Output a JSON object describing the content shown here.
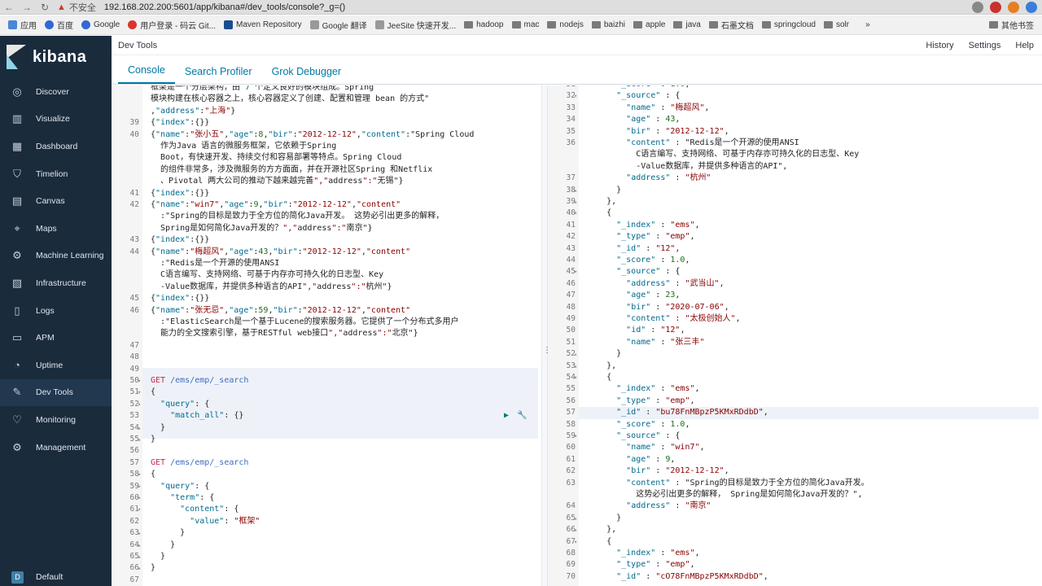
{
  "browser": {
    "warning": "不安全",
    "url": "192.168.202.200:5601/app/kibana#/dev_tools/console?_g=()"
  },
  "bookmarks": [
    {
      "label": "应用",
      "icon": "grid"
    },
    {
      "label": "百度",
      "icon": "paw"
    },
    {
      "label": "Google",
      "icon": "google"
    },
    {
      "label": "用户登录 - 码云 Git...",
      "icon": "gitee"
    },
    {
      "label": "Maven Repository",
      "icon": "mvn"
    },
    {
      "label": "Google 翻译",
      "icon": "translate"
    },
    {
      "label": "JeeSite 快速开发...",
      "icon": "jeesite"
    },
    {
      "label": "hadoop",
      "icon": "folder"
    },
    {
      "label": "mac",
      "icon": "folder"
    },
    {
      "label": "nodejs",
      "icon": "folder"
    },
    {
      "label": "baizhi",
      "icon": "folder"
    },
    {
      "label": "apple",
      "icon": "folder"
    },
    {
      "label": "java",
      "icon": "folder"
    },
    {
      "label": "石墨文档",
      "icon": "folder"
    },
    {
      "label": "springcloud",
      "icon": "folder"
    },
    {
      "label": "solr",
      "icon": "folder"
    }
  ],
  "bookmarks_more": "»",
  "bookmarks_other": "其他书签",
  "sidebar": {
    "brand": "kibana",
    "items": [
      {
        "label": "Discover",
        "icon": "compass-icon",
        "glyph": "◎",
        "active": false
      },
      {
        "label": "Visualize",
        "icon": "chart-icon",
        "glyph": "▥",
        "active": false
      },
      {
        "label": "Dashboard",
        "icon": "dashboard-icon",
        "glyph": "▦",
        "active": false
      },
      {
        "label": "Timelion",
        "icon": "shield-icon",
        "glyph": "⛉",
        "active": false
      },
      {
        "label": "Canvas",
        "icon": "canvas-icon",
        "glyph": "▤",
        "active": false
      },
      {
        "label": "Maps",
        "icon": "map-pin-icon",
        "glyph": "⌖",
        "active": false
      },
      {
        "label": "Machine Learning",
        "icon": "ml-icon",
        "glyph": "⚙",
        "active": false
      },
      {
        "label": "Infrastructure",
        "icon": "infra-icon",
        "glyph": "▧",
        "active": false
      },
      {
        "label": "Logs",
        "icon": "logs-icon",
        "glyph": "▯",
        "active": false
      },
      {
        "label": "APM",
        "icon": "apm-icon",
        "glyph": "▭",
        "active": false
      },
      {
        "label": "Uptime",
        "icon": "uptime-icon",
        "glyph": "◔",
        "active": false
      },
      {
        "label": "Dev Tools",
        "icon": "wrench-icon",
        "glyph": "✎",
        "active": true
      },
      {
        "label": "Monitoring",
        "icon": "heartbeat-icon",
        "glyph": "♡",
        "active": false
      },
      {
        "label": "Management",
        "icon": "gear-icon",
        "glyph": "⚙",
        "active": false
      }
    ],
    "space_initial": "D",
    "space_label": "Default"
  },
  "header": {
    "title": "Dev Tools",
    "links": [
      "History",
      "Settings",
      "Help"
    ]
  },
  "tabs": [
    {
      "label": "Console",
      "active": true
    },
    {
      "label": "Search Profiler",
      "active": false
    },
    {
      "label": "Grok Debugger",
      "active": false
    }
  ],
  "left_editor": [
    {
      "n": "",
      "text": "框架是一个分层架构，由 7 个定义良好的模块组成。Spring"
    },
    {
      "n": "",
      "text": "模块构建在核心容器之上，核心容器定义了创建、配置和管理 bean 的方式\""
    },
    {
      "n": "",
      "text": ",\"address\":\"上海\"}"
    },
    {
      "n": "39",
      "text": "{\"index\":{}}"
    },
    {
      "n": "40",
      "text": "{\"name\":\"张小五\",\"age\":8,\"bir\":\"2012-12-12\",\"content\":\"Spring Cloud"
    },
    {
      "n": "",
      "text": "  作为Java 语言的微服务框架，它依赖于Spring"
    },
    {
      "n": "",
      "text": "  Boot，有快速开发、持续交付和容易部署等特点。Spring Cloud"
    },
    {
      "n": "",
      "text": "  的组件非常多，涉及微服务的方方面面，并在开源社区Spring 和Netflix"
    },
    {
      "n": "",
      "text": "  、Pivotal 两大公司的推动下越来越完善\",\"address\":\"无锡\"}"
    },
    {
      "n": "41",
      "text": "{\"index\":{}}"
    },
    {
      "n": "42",
      "text": "{\"name\":\"win7\",\"age\":9,\"bir\":\"2012-12-12\",\"content\""
    },
    {
      "n": "",
      "text": "  :\"Spring的目标是致力于全方位的简化Java开发。 这势必引出更多的解释，"
    },
    {
      "n": "",
      "text": "  Spring是如何简化Java开发的？\",\"address\":\"南京\"}"
    },
    {
      "n": "43",
      "text": "{\"index\":{}}"
    },
    {
      "n": "44",
      "text": "{\"name\":\"梅超风\",\"age\":43,\"bir\":\"2012-12-12\",\"content\""
    },
    {
      "n": "",
      "text": "  :\"Redis是一个开源的使用ANSI"
    },
    {
      "n": "",
      "text": "  C语言编写、支持网络、可基于内存亦可持久化的日志型、Key"
    },
    {
      "n": "",
      "text": "  -Value数据库，并提供多种语言的API\",\"address\":\"杭州\"}"
    },
    {
      "n": "45",
      "text": "{\"index\":{}}"
    },
    {
      "n": "46",
      "text": "{\"name\":\"张无忌\",\"age\":59,\"bir\":\"2012-12-12\",\"content\""
    },
    {
      "n": "",
      "text": "  :\"ElasticSearch是一个基于Lucene的搜索服务器。它提供了一个分布式多用户"
    },
    {
      "n": "",
      "text": "  能力的全文搜索引擎，基于RESTful web接口\",\"address\":\"北京\"}"
    },
    {
      "n": "47",
      "text": ""
    },
    {
      "n": "48",
      "text": ""
    },
    {
      "n": "49",
      "text": ""
    },
    {
      "n": "50",
      "text": "GET /ems/emp/_search",
      "kind": "request",
      "fold": "▾"
    },
    {
      "n": "51",
      "text": "{",
      "fold": "▾"
    },
    {
      "n": "52",
      "text": "  \"query\": {",
      "fold": "▾"
    },
    {
      "n": "53",
      "text": "    \"match_all\": {}"
    },
    {
      "n": "54",
      "text": "  }",
      "fold": "▴"
    },
    {
      "n": "55",
      "text": "}",
      "fold": "▴"
    },
    {
      "n": "56",
      "text": ""
    },
    {
      "n": "57",
      "text": "GET /ems/emp/_search",
      "kind": "request"
    },
    {
      "n": "58",
      "text": "{",
      "fold": "▾"
    },
    {
      "n": "59",
      "text": "  \"query\": {",
      "fold": "▾"
    },
    {
      "n": "60",
      "text": "    \"term\": {",
      "fold": "▾"
    },
    {
      "n": "61",
      "text": "      \"content\": {",
      "fold": "▾"
    },
    {
      "n": "62",
      "text": "        \"value\": \"框架\""
    },
    {
      "n": "63",
      "text": "      }",
      "fold": "▴"
    },
    {
      "n": "64",
      "text": "    }",
      "fold": "▴"
    },
    {
      "n": "65",
      "text": "  }",
      "fold": "▴"
    },
    {
      "n": "66",
      "text": "}",
      "fold": "▴"
    },
    {
      "n": "67",
      "text": ""
    }
  ],
  "right_editor": [
    {
      "n": "31",
      "text": "      \"_score\" : 1.0,"
    },
    {
      "n": "32",
      "text": "      \"_source\" : {",
      "fold": "▾"
    },
    {
      "n": "33",
      "text": "        \"name\" : \"梅超风\","
    },
    {
      "n": "34",
      "text": "        \"age\" : 43,"
    },
    {
      "n": "35",
      "text": "        \"bir\" : \"2012-12-12\","
    },
    {
      "n": "36",
      "text": "        \"content\" : \"Redis是一个开源的使用ANSI"
    },
    {
      "n": "",
      "text": "          C语言编写、支持网络、可基于内存亦可持久化的日志型、Key"
    },
    {
      "n": "",
      "text": "          -Value数据库，并提供多种语言的API\","
    },
    {
      "n": "37",
      "text": "        \"address\" : \"杭州\""
    },
    {
      "n": "38",
      "text": "      }",
      "fold": "▴"
    },
    {
      "n": "39",
      "text": "    },",
      "fold": "▴"
    },
    {
      "n": "40",
      "text": "    {",
      "fold": "▾"
    },
    {
      "n": "41",
      "text": "      \"_index\" : \"ems\","
    },
    {
      "n": "42",
      "text": "      \"_type\" : \"emp\","
    },
    {
      "n": "43",
      "text": "      \"_id\" : \"12\","
    },
    {
      "n": "44",
      "text": "      \"_score\" : 1.0,"
    },
    {
      "n": "45",
      "text": "      \"_source\" : {",
      "fold": "▾"
    },
    {
      "n": "46",
      "text": "        \"address\" : \"武当山\","
    },
    {
      "n": "47",
      "text": "        \"age\" : 23,"
    },
    {
      "n": "48",
      "text": "        \"bir\" : \"2020-07-06\","
    },
    {
      "n": "49",
      "text": "        \"content\" : \"太极创始人\","
    },
    {
      "n": "50",
      "text": "        \"id\" : \"12\","
    },
    {
      "n": "51",
      "text": "        \"name\" : \"张三丰\""
    },
    {
      "n": "52",
      "text": "      }",
      "fold": "▴"
    },
    {
      "n": "53",
      "text": "    },",
      "fold": "▴"
    },
    {
      "n": "54",
      "text": "    {",
      "fold": "▾"
    },
    {
      "n": "55",
      "text": "      \"_index\" : \"ems\","
    },
    {
      "n": "56",
      "text": "      \"_type\" : \"emp\","
    },
    {
      "n": "57",
      "text": "      \"_id\" : \"bu78FnMBpzP5KMxRDdbD\",",
      "highlight": true
    },
    {
      "n": "58",
      "text": "      \"_score\" : 1.0,"
    },
    {
      "n": "59",
      "text": "      \"_source\" : {",
      "fold": "▾"
    },
    {
      "n": "60",
      "text": "        \"name\" : \"win7\","
    },
    {
      "n": "61",
      "text": "        \"age\" : 9,"
    },
    {
      "n": "62",
      "text": "        \"bir\" : \"2012-12-12\","
    },
    {
      "n": "63",
      "text": "        \"content\" : \"Spring的目标是致力于全方位的简化Java开发。"
    },
    {
      "n": "",
      "text": "          这势必引出更多的解释， Spring是如何简化Java开发的？\","
    },
    {
      "n": "64",
      "text": "        \"address\" : \"南京\""
    },
    {
      "n": "65",
      "text": "      }",
      "fold": "▴"
    },
    {
      "n": "66",
      "text": "    },",
      "fold": "▴"
    },
    {
      "n": "67",
      "text": "    {",
      "fold": "▾"
    },
    {
      "n": "68",
      "text": "      \"_index\" : \"ems\","
    },
    {
      "n": "69",
      "text": "      \"_type\" : \"emp\","
    },
    {
      "n": "70",
      "text": "      \"_id\" : \"cO78FnMBpzP5KMxRDdbD\","
    }
  ],
  "colors": {
    "sidebar_bg": "#1a2b3c",
    "accent": "#0079a5",
    "request_keyword": "#c7254e"
  }
}
